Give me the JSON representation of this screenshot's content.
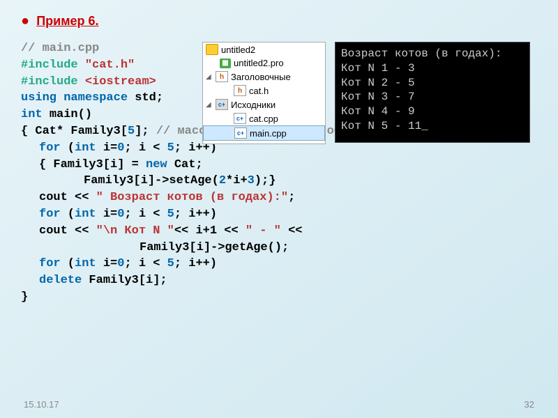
{
  "title": "Пример 6.",
  "code": {
    "c1": "// main.cpp",
    "inc1a": "#include ",
    "inc1b": "\"cat.h\"",
    "inc2a": "#include ",
    "inc2b": "<iostream>",
    "ns1": "using",
    "ns2": "namespace",
    "ns3": "std;",
    "main1": "int",
    "main2": "main()",
    "lb1": "{ Cat* Family3[",
    "five1": "5",
    "rb1": "];",
    "cm2": " // массив указателей на объекты",
    "for1a": "for",
    "for1b": " (",
    "for1c": "int",
    "for1d": " i=",
    "zero1": "0",
    "for1e": "; i < ",
    "five2": "5",
    "for1f": "; i++)",
    "body1a": " { Family3[i] = ",
    "new1": "new",
    "body1b": " Cat;",
    "body2a": "Family3[i]->setAge(",
    "expr1": "2",
    "body2b": "*i+",
    "expr2": "3",
    "body2c": ");}",
    "cout1a": "cout << ",
    "str1": "\" Возраст котов (в годах):\"",
    "cout1b": ";",
    "for2a": "for",
    "for2b": " (",
    "for2c": "int",
    "for2d": " i=",
    "zero2": "0",
    "for2e": "; i < ",
    "five3": "5",
    "for2f": "; i++)",
    "cout2a": " cout << ",
    "str2": "\"\\n Кот N \"",
    "cout2b": "<< i+1 << ",
    "str3": "\" - \"",
    "cout2c": " <<",
    "cout3": "Family3[i]->getAge();",
    "for3a": "for",
    "for3b": " (",
    "for3c": "int",
    "for3d": " i=",
    "zero3": "0",
    "for3e": "; i < ",
    "five4": "5",
    "for3f": "; i++)",
    "del1": " delete",
    "del2": " Family3[i];",
    "close": "}"
  },
  "tree": {
    "root": "untitled2",
    "items": [
      "untitled2.pro",
      "Заголовочные",
      "cat.h",
      "Исходники",
      "cat.cpp",
      "main.cpp"
    ]
  },
  "console": {
    "line0": " Возраст котов (в годах):",
    "line1": " Кот N 1 - 3",
    "line2": " Кот N 2 - 5",
    "line3": " Кот N 3 - 7",
    "line4": " Кот N 4 - 9",
    "line5": " Кот N 5 - 11_"
  },
  "footer": {
    "date": "15.10.17",
    "page": "32"
  }
}
